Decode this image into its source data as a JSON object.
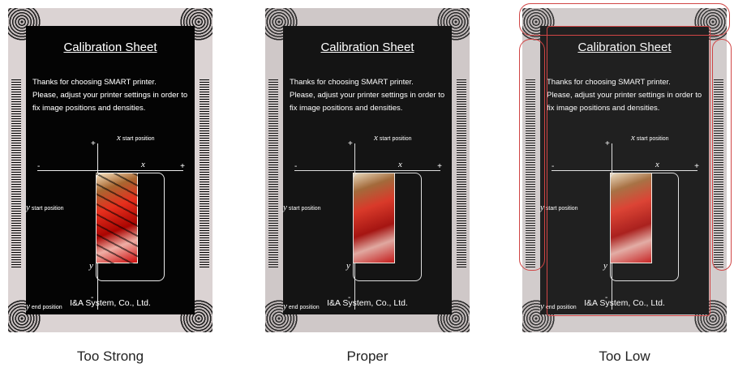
{
  "card": {
    "title": "Calibration Sheet",
    "line1": "Thanks for choosing SMART printer.",
    "line2": "Please, adjust your printer settings in order to fix image positions and densities.",
    "x_axis": "x",
    "y_axis": "y",
    "x_start": "start position",
    "y_start": "start position",
    "y_end": "end position",
    "x_prefix": "x",
    "y_prefix": "y",
    "plus": "+",
    "minus": "-",
    "company": "I&A System, Co., Ltd."
  },
  "panels": [
    {
      "caption": "Too Strong",
      "density": "strong"
    },
    {
      "caption": "Proper",
      "density": "proper"
    },
    {
      "caption": "Too Low",
      "density": "low"
    }
  ],
  "colors": {
    "highlight": "#d04545",
    "card_bg": "#cfc8c8",
    "inner_bg": "#141414"
  }
}
